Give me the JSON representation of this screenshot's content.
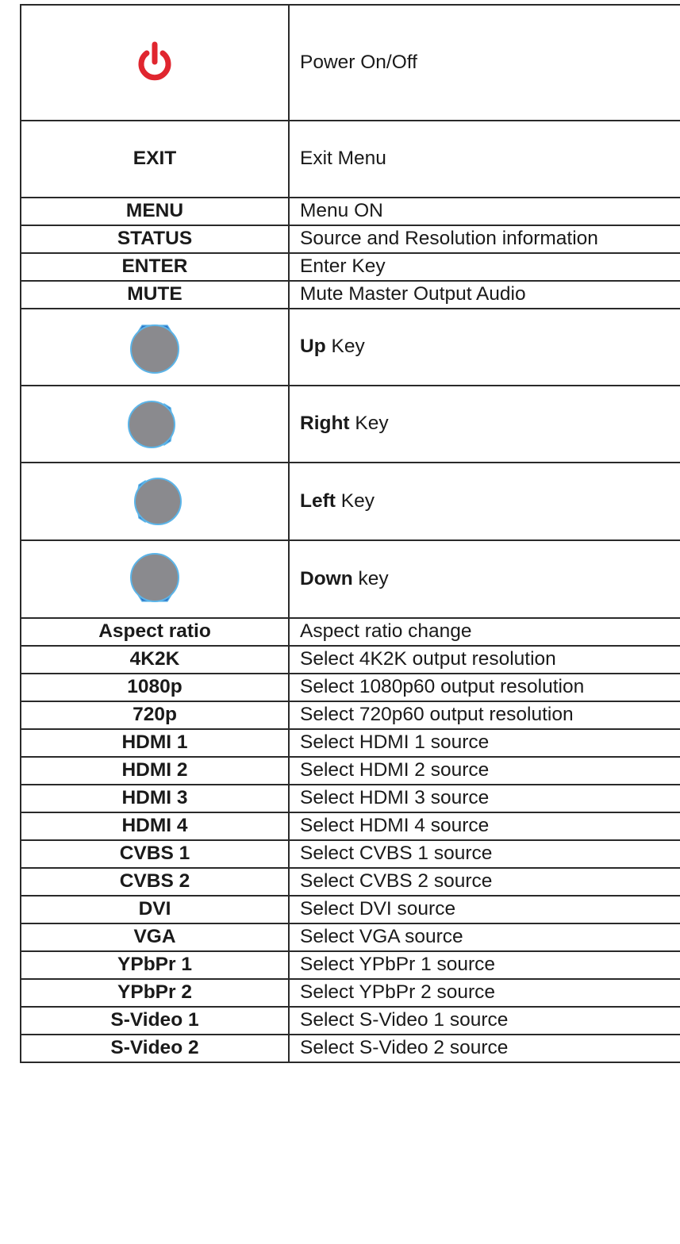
{
  "rows": [
    {
      "key": "",
      "icon": "power-icon",
      "desc_bold": "",
      "desc": "Power On/Off"
    },
    {
      "key": "EXIT",
      "desc_bold": "",
      "desc": "Exit Menu"
    },
    {
      "key": "MENU",
      "desc_bold": "",
      "desc": "Menu ON"
    },
    {
      "key": "STATUS",
      "desc_bold": "",
      "desc": "Source and Resolution information"
    },
    {
      "key": "ENTER",
      "desc_bold": "",
      "desc": "Enter Key"
    },
    {
      "key": "MUTE",
      "desc_bold": "",
      "desc": "Mute Master Output Audio"
    },
    {
      "key": "",
      "icon": "up-arrow-button-icon",
      "desc_bold": "Up",
      "desc": " Key"
    },
    {
      "key": "",
      "icon": "right-arrow-button-icon",
      "desc_bold": "Right",
      "desc": " Key"
    },
    {
      "key": "",
      "icon": "left-arrow-button-icon",
      "desc_bold": "Left",
      "desc": " Key"
    },
    {
      "key": "",
      "icon": "down-arrow-button-icon",
      "desc_bold": "Down",
      "desc": " key"
    },
    {
      "key": "Aspect ratio",
      "desc_bold": "",
      "desc": "Aspect ratio change"
    },
    {
      "key": "4K2K",
      "desc_bold": "",
      "desc": "Select 4K2K output resolution"
    },
    {
      "key": "1080p",
      "desc_bold": "",
      "desc": "Select 1080p60 output resolution"
    },
    {
      "key": "720p",
      "desc_bold": "",
      "desc": "Select 720p60 output resolution"
    },
    {
      "key": "HDMI 1",
      "desc_bold": "",
      "desc": "Select HDMI 1 source"
    },
    {
      "key": "HDMI 2",
      "desc_bold": "",
      "desc": "Select HDMI 2 source"
    },
    {
      "key": "HDMI 3",
      "desc_bold": "",
      "desc": "Select HDMI 3 source"
    },
    {
      "key": "HDMI 4",
      "desc_bold": "",
      "desc": "Select HDMI 4 source"
    },
    {
      "key": "CVBS 1",
      "desc_bold": "",
      "desc": "Select CVBS 1 source"
    },
    {
      "key": "CVBS 2",
      "desc_bold": "",
      "desc": "Select CVBS 2 source"
    },
    {
      "key": "DVI",
      "desc_bold": "",
      "desc": "Select DVI source"
    },
    {
      "key": "VGA",
      "desc_bold": "",
      "desc": "Select VGA source"
    },
    {
      "key": "YPbPr 1",
      "desc_bold": "",
      "desc": "Select YPbPr 1 source"
    },
    {
      "key": "YPbPr 2",
      "desc_bold": "",
      "desc": "Select YPbPr 2 source"
    },
    {
      "key": "S-Video 1",
      "desc_bold": "",
      "desc": "Select S-Video 1 source"
    },
    {
      "key": "S-Video 2",
      "desc_bold": "",
      "desc": "Select S-Video 2 source"
    }
  ],
  "colors": {
    "power_red": "#e0262f",
    "button_gray": "#8a8a8e",
    "button_blue": "#2e6fc4",
    "button_rim": "#5bb4e8"
  }
}
